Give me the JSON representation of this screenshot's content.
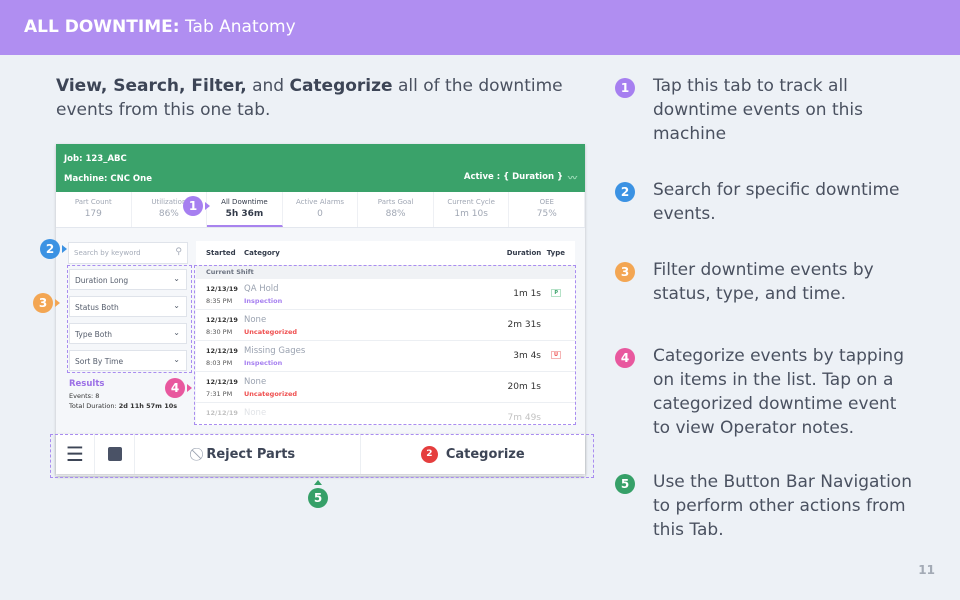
{
  "header": {
    "title_bold": "ALL DOWNTIME:",
    "title_rest": " Tab Anatomy"
  },
  "intro": {
    "b1": "View, Search, Filter,",
    "t1": " and ",
    "b2": "Categorize",
    "t2": " all of the downtime events from this one tab."
  },
  "app": {
    "job": "Job: 123_ABC",
    "machine": "Machine: CNC One",
    "active": "Active : { Duration }",
    "stats": [
      {
        "label": "Part Count",
        "value": "179"
      },
      {
        "label": "Utilization",
        "value": "86%"
      },
      {
        "label": "All Downtime",
        "value": "5h 36m",
        "active": true
      },
      {
        "label": "Active Alarms",
        "value": "0"
      },
      {
        "label": "Parts Goal",
        "value": "88%"
      },
      {
        "label": "Current Cycle",
        "value": "1m 10s"
      },
      {
        "label": "OEE",
        "value": "75%"
      }
    ],
    "search_placeholder": "Search by keyword",
    "filters": [
      "Duration  Long",
      "Status  Both",
      "Type  Both",
      "Sort By  Time"
    ],
    "results": {
      "title": "Results",
      "events": "Events: 8",
      "total_label": "Total Duration: ",
      "total": "2d 11h 57m 10s"
    },
    "table": {
      "headers": {
        "started": "Started",
        "category": "Category",
        "duration": "Duration",
        "type": "Type"
      },
      "group": "Current Shift",
      "rows": [
        {
          "date": "12/13/19",
          "time": "8:35 PM",
          "category": "QA Hold",
          "status": "Inspection",
          "duration": "1m 1s",
          "type": "P"
        },
        {
          "date": "12/12/19",
          "time": "8:30 PM",
          "category": "None",
          "status": "Uncategorized",
          "duration": "2m 31s",
          "type": ""
        },
        {
          "date": "12/12/19",
          "time": "8:03 PM",
          "category": "Missing Gages",
          "status": "Inspection",
          "duration": "3m 4s",
          "type": "U"
        },
        {
          "date": "12/12/19",
          "time": "7:31 PM",
          "category": "None",
          "status": "Uncategorized",
          "duration": "20m 1s",
          "type": ""
        },
        {
          "date": "12/12/19",
          "time": "",
          "category": "None",
          "status": "",
          "duration": "7m 49s",
          "type": ""
        }
      ]
    },
    "buttons": {
      "reject": "Reject Parts",
      "categorize": "Categorize",
      "categorize_badge": "2"
    }
  },
  "callouts": [
    {
      "n": "1",
      "text": "Tap this tab to track all downtime events on this machine",
      "color": "#a67ff0"
    },
    {
      "n": "2",
      "text": "Search for specific downtime events.",
      "color": "#3b92e3"
    },
    {
      "n": "3",
      "text": "Filter downtime events by status, type, and time.",
      "color": "#f3a653"
    },
    {
      "n": "4",
      "text": "Categorize events by tapping on items in the list. Tap on a categorized downtime event to view Operator notes.",
      "color": "#e8589e"
    },
    {
      "n": "5",
      "text": "Use the Button Bar Navigation to perform other actions from this Tab.",
      "color": "#36a068"
    }
  ],
  "colors": {
    "header": "#b08ef1",
    "green": "#3aa26a",
    "inspection": "#a67ff0",
    "uncategorized": "#ef4f4f"
  },
  "page_number": "11"
}
